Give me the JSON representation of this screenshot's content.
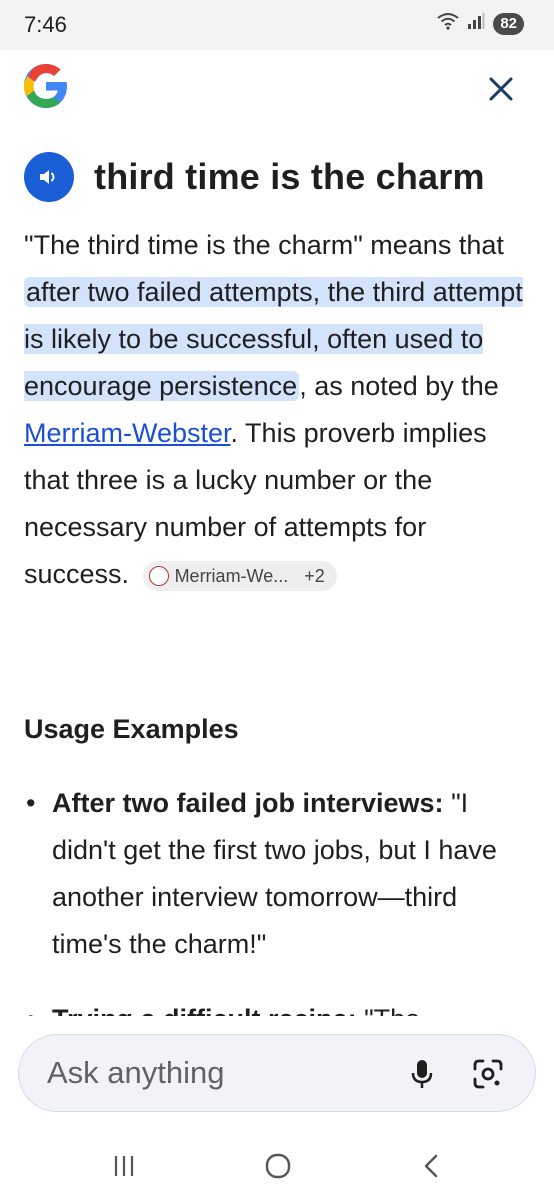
{
  "status_bar": {
    "time": "7:46",
    "battery": "82",
    "icons": [
      "wifi-icon",
      "signal-icon",
      "battery-icon"
    ]
  },
  "header": {
    "logo": "google-g-logo",
    "close_icon": "close-icon"
  },
  "term": {
    "title": "third time is the charm",
    "speaker_icon": "speaker-icon"
  },
  "definition": {
    "intro": "\"The third time is the charm\" means that ",
    "highlight": "after two failed attempts, the third attempt is likely to be successful, often used to encourage persistence",
    "mid": ", as noted by the ",
    "link": "Merriam-Webster",
    "rest": ". This proverb implies that three is a lucky number or the necessary number of attempts for success.",
    "source_chip": {
      "label": "Merriam-We...",
      "more": "+2"
    }
  },
  "usage": {
    "title": "Usage Examples",
    "items": [
      {
        "title": "After two failed job interviews:",
        "text": " \"I didn't get the first two jobs, but I have another interview tomorrow—third time's the charm!\""
      },
      {
        "title": "Trying a difficult recipe:",
        "text": " \"The"
      }
    ]
  },
  "ask_bar": {
    "placeholder": "Ask anything",
    "mic_icon": "mic-icon",
    "lens_icon": "lens-icon"
  },
  "nav_bar": {
    "icons": [
      "recent-apps-icon",
      "home-icon",
      "back-icon"
    ]
  },
  "colors": {
    "accent": "#1a5fd6",
    "highlight": "#d4e3fc",
    "link": "#1a4fd6"
  }
}
